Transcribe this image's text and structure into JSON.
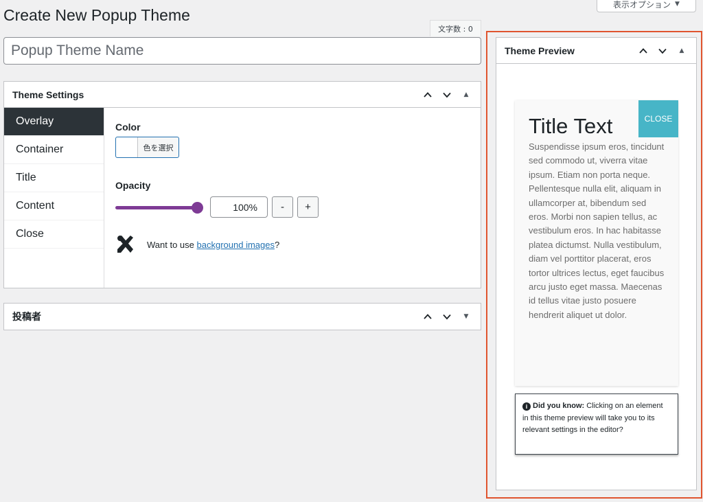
{
  "screen_options": {
    "label": "表示オプション"
  },
  "page": {
    "title": "Create New Popup Theme"
  },
  "editor": {
    "char_count": "文字数 : 0",
    "title_placeholder": "Popup Theme Name"
  },
  "theme_settings": {
    "heading": "Theme Settings",
    "tabs": [
      {
        "label": "Overlay",
        "active": true
      },
      {
        "label": "Container"
      },
      {
        "label": "Title"
      },
      {
        "label": "Content"
      },
      {
        "label": "Close"
      }
    ],
    "overlay": {
      "color_label": "Color",
      "color_button": "色を選択",
      "opacity_label": "Opacity",
      "opacity_value": "100%",
      "opacity_fraction": 1.0,
      "minus": "-",
      "plus": "+",
      "bg_prefix": "Want to use ",
      "bg_link": "background images",
      "bg_suffix": "?"
    },
    "accent_color": "#7e3b95"
  },
  "author_box": {
    "heading": "投稿者"
  },
  "preview": {
    "heading": "Theme Preview",
    "close_label": "CLOSE",
    "popup_title": "Title Text",
    "popup_content": "Suspendisse ipsum eros, tincidunt sed commodo ut, viverra vitae ipsum. Etiam non porta neque. Pellentesque nulla elit, aliquam in ullamcorper at, bibendum sed eros. Morbi non sapien tellus, ac vestibulum eros. In hac habitasse platea dictumst. Nulla vestibulum, diam vel porttitor placerat, eros tortor ultrices lectus, eget faucibus arcu justo eget massa. Maecenas id tellus vitae justo posuere hendrerit aliquet ut dolor.",
    "tip_strong": "Did you know:",
    "tip_text": " Clicking on an element in this theme preview will take you to its relevant settings in the editor?",
    "close_color": "#47b5c7",
    "highlight_color": "#e0542e"
  }
}
